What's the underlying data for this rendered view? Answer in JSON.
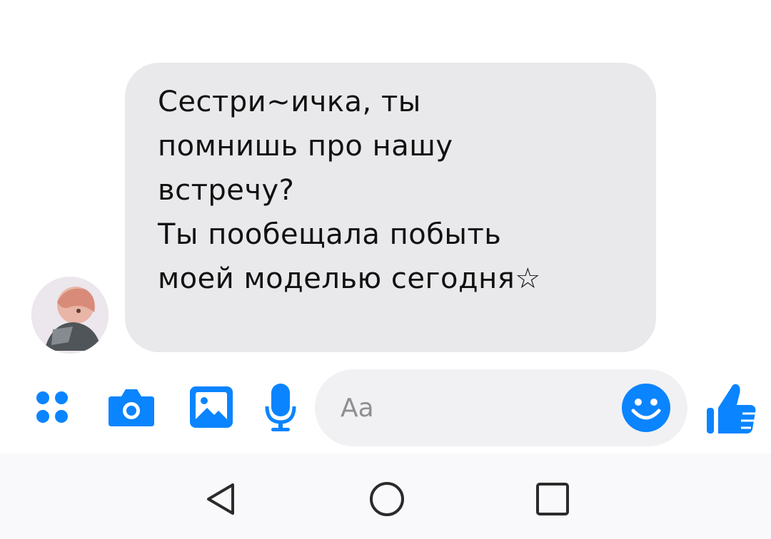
{
  "chat": {
    "message_lines": [
      "Сестри~ичка, ты",
      "помнишь про нашу",
      "встречу?",
      "Ты пообещала побыть",
      "моей моделью сегодня☆"
    ]
  },
  "composer": {
    "placeholder": "Aa",
    "icons": [
      "apps-icon",
      "camera-icon",
      "gallery-icon",
      "microphone-icon",
      "emoji-icon",
      "thumbs-up-icon"
    ],
    "accent_color": "#0a84ff"
  },
  "navbar": {
    "icons": [
      "back-triangle-icon",
      "home-circle-icon",
      "recents-square-icon"
    ]
  }
}
